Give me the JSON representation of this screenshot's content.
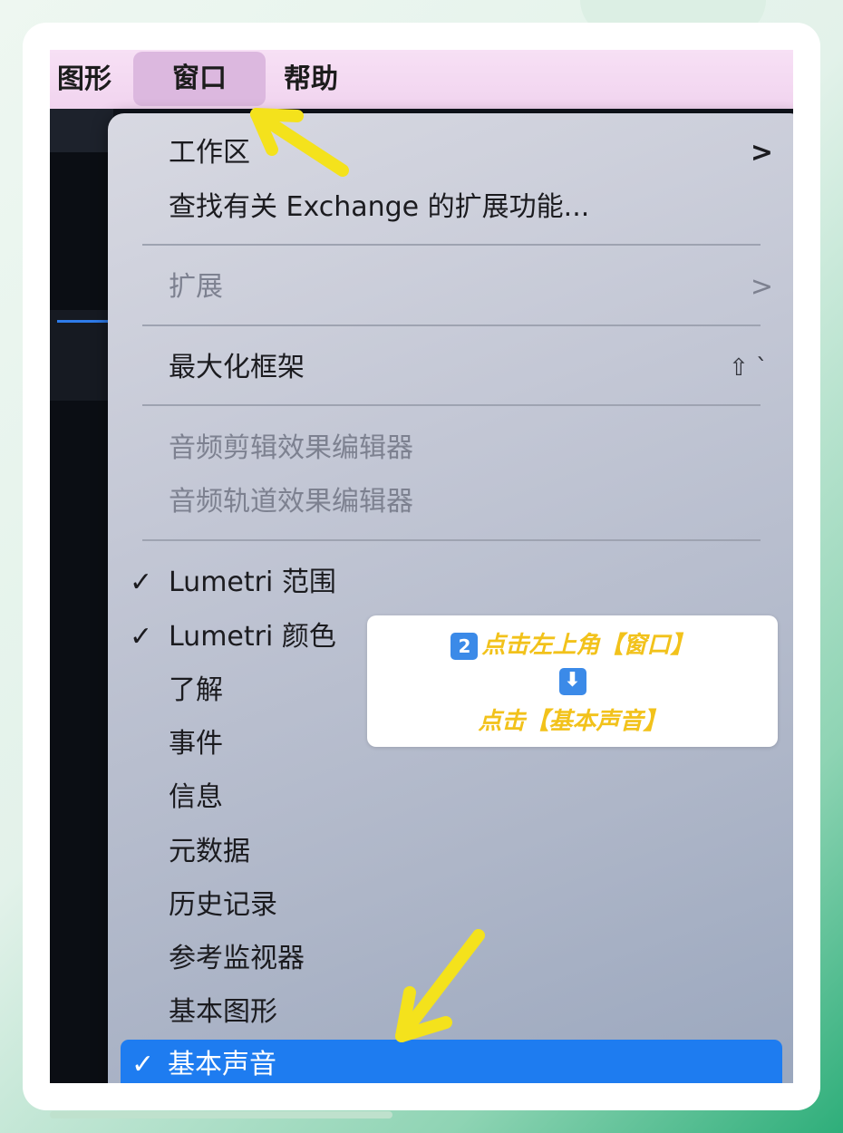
{
  "menubar": {
    "items": [
      {
        "label": "图形"
      },
      {
        "label": "窗口"
      },
      {
        "label": "帮助"
      }
    ]
  },
  "menu": {
    "workspace": {
      "label": "工作区",
      "arrow": ">"
    },
    "exchange": {
      "label": "查找有关 Exchange 的扩展功能..."
    },
    "extensions": {
      "label": "扩展",
      "arrow": ">"
    },
    "maximize": {
      "label": "最大化框架",
      "shortcut": "⇧ `"
    },
    "audio_clip_fx": {
      "label": "音频剪辑效果编辑器"
    },
    "audio_track_fx": {
      "label": "音频轨道效果编辑器"
    },
    "lumetri_scopes": {
      "label": "Lumetri 范围",
      "check": "✓"
    },
    "lumetri_color": {
      "label": "Lumetri 颜色",
      "check": "✓"
    },
    "learn": {
      "label": "了解"
    },
    "events": {
      "label": "事件"
    },
    "info": {
      "label": "信息"
    },
    "metadata": {
      "label": "元数据"
    },
    "history": {
      "label": "历史记录"
    },
    "reference_monitor": {
      "label": "参考监视器"
    },
    "essential_graphics": {
      "label": "基本图形"
    },
    "essential_sound": {
      "label": "基本声音",
      "check": "✓"
    }
  },
  "callout": {
    "step_badge": "2",
    "line1": "点击左上角【窗口】",
    "down_glyph": "⬇",
    "line3": "点击【基本声音】"
  },
  "colors": {
    "selection": "#1e7cf0",
    "annotation_arrow": "#f4e21c",
    "callout_text": "#f2c21b"
  }
}
